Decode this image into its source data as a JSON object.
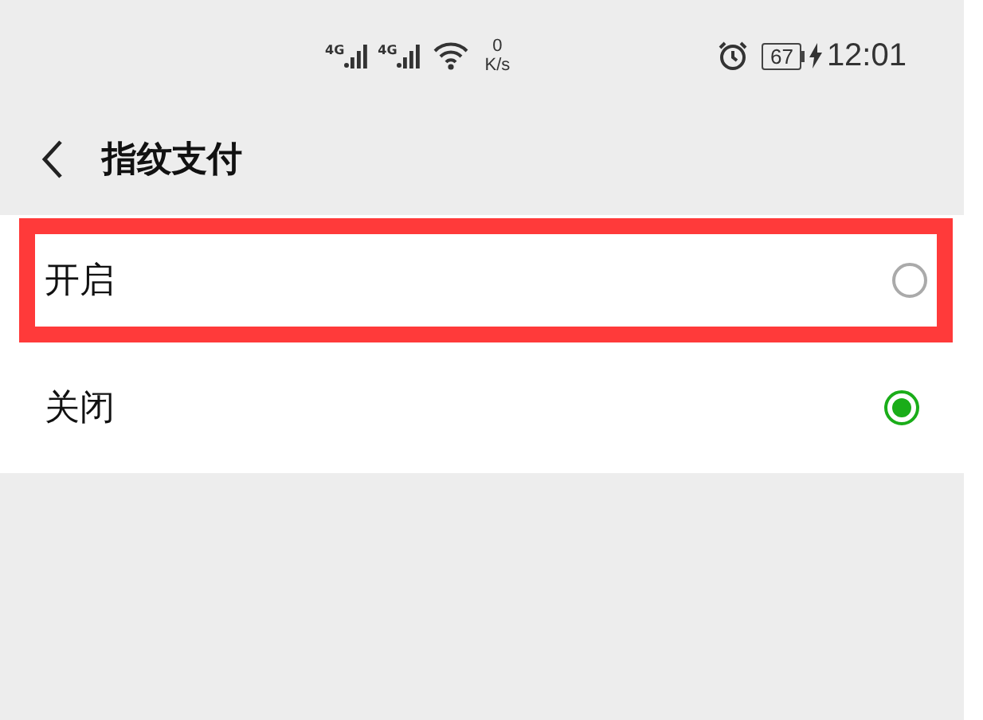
{
  "status_bar": {
    "networks": [
      {
        "label": "4G"
      },
      {
        "label": "4G"
      }
    ],
    "speed_value": "0",
    "speed_unit": "K/s",
    "battery": "67",
    "charging": true,
    "time": "12:01"
  },
  "header": {
    "title": "指纹支付"
  },
  "options": [
    {
      "label": "开启",
      "selected": false,
      "highlighted": true
    },
    {
      "label": "关闭",
      "selected": true,
      "highlighted": false
    }
  ]
}
